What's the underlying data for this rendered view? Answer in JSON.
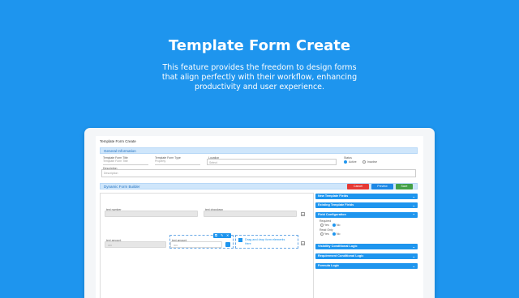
{
  "hero": {
    "title": "Template Form Create",
    "subtitle": "This feature provides the freedom to design forms that align perfectly with their workflow, enhancing productivity and user experience."
  },
  "app": {
    "page_title": "Template Form Create",
    "general_info": {
      "header": "General Information",
      "title_label": "Template Form Title",
      "title_placeholder": "Template Form Title",
      "type_label": "Template Form Type",
      "type_value": "Property",
      "location_label": "Location",
      "location_placeholder": "Select",
      "status_label": "Status",
      "status_active": "Active",
      "status_inactive": "Inactive",
      "description_label": "Description",
      "description_placeholder": "Description"
    },
    "builder": {
      "header": "Dynamic Form Builder",
      "cancel": "Cancel",
      "preview": "Preview",
      "save": "Save",
      "field_text_number": "text number",
      "field_text_dropdown": "text dropdown",
      "field_text_amount_1": "text amount",
      "field_text_amount_1_value": "000",
      "field_text_amount_2": "text amount",
      "field_text_amount_2_value": "000",
      "drop_hint": "Drag and drop form elements",
      "drop_hint_sub": "Here"
    },
    "side_panel": {
      "new_fields": "New Template Fields",
      "existing_fields": "Existing Template Fields",
      "field_config": "Field Configuration",
      "required_label": "Required",
      "read_only_label": "Read Only",
      "yes": "Yes",
      "no": "No",
      "visibility_logic": "Visibility Conditional Logic",
      "requirement_logic": "Requirement Conditional Logic",
      "formula_logic": "Formula Logic"
    },
    "colors": {
      "accent": "#1e95ee",
      "cancel": "#e53935",
      "preview": "#1e88e5",
      "save": "#43a047"
    }
  }
}
